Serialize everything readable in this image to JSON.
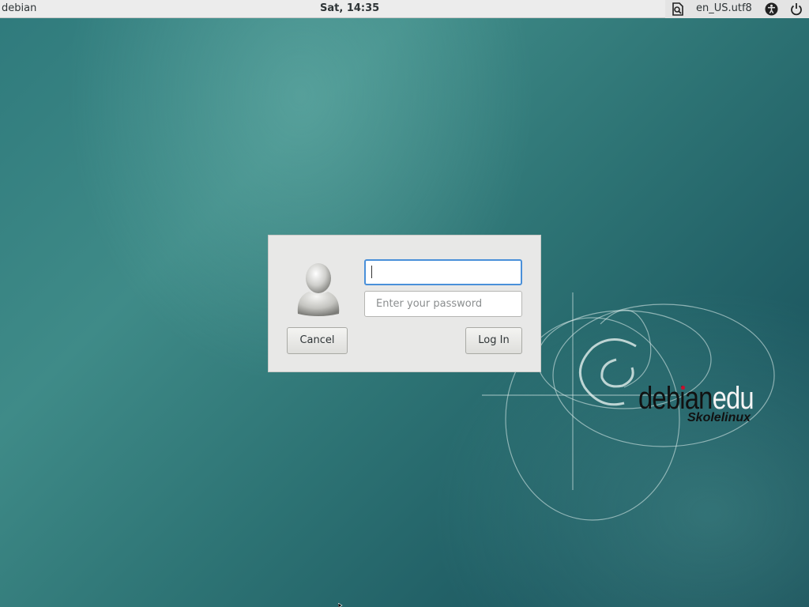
{
  "topbar": {
    "hostname": "debian",
    "clock": "Sat, 14:35",
    "locale": "en_US.utf8",
    "icons": [
      "keyboard-layout-icon",
      "accessibility-icon",
      "power-icon"
    ]
  },
  "login": {
    "username_value": "",
    "password_placeholder": "Enter your password",
    "cancel_label": "Cancel",
    "login_label": "Log In"
  },
  "branding": {
    "logo_main_dark": "debian",
    "logo_main_light": "edu",
    "logo_sub": "Skolelinux"
  },
  "colors": {
    "accent_focus": "#4a90d9",
    "background": "#2f7a7c",
    "dialog": "#e8e8e7",
    "topbar": "#ececec"
  }
}
